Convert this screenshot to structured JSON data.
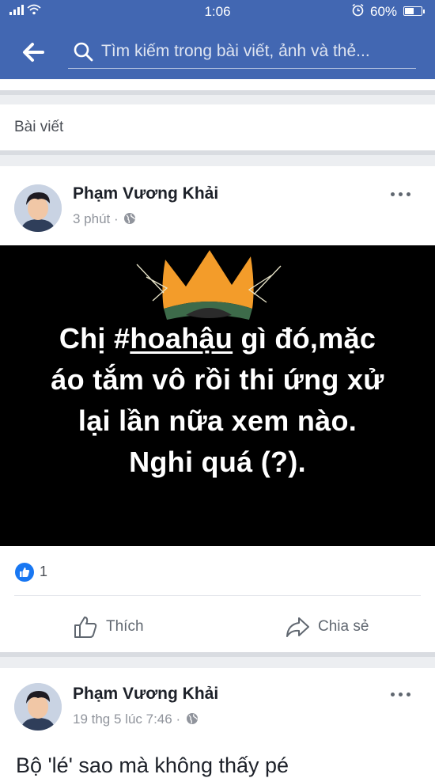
{
  "status_bar": {
    "time": "1:06",
    "battery": "60%",
    "battery_level": 0.6
  },
  "search": {
    "placeholder": "Tìm kiếm trong bài viết, ảnh và thẻ..."
  },
  "section": {
    "title": "Bài viết"
  },
  "posts": [
    {
      "author": "Phạm Vương Khải",
      "time": "3 phút",
      "separator": "·",
      "image_text": {
        "line1_before": "Chị #",
        "hashtag": "hoahậu",
        "line1_after": " gì đó,mặc",
        "line2": "áo tắm vô rồi thi ứng xử",
        "line3": "lại lần nữa xem nào.",
        "line4": "Nghi quá (?)."
      },
      "reaction_count": "1",
      "actions": {
        "like": "Thích",
        "share": "Chia sẻ"
      }
    },
    {
      "author": "Phạm Vương Khải",
      "time": "19 thg 5 lúc 7:46",
      "separator": "·",
      "text_preview": "Bộ 'lé' sao mà không thấy pé"
    }
  ],
  "colors": {
    "brand": "#4267b2",
    "like_blue": "#1877f2",
    "crown_orange": "#f39c2a"
  },
  "icons": [
    "back-arrow-icon",
    "search-icon",
    "globe-icon",
    "more-icon",
    "like-thumb-icon",
    "share-icon",
    "alarm-icon",
    "wifi-icon"
  ]
}
